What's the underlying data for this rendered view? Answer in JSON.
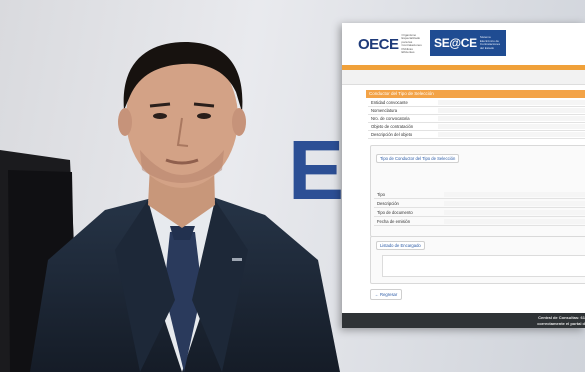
{
  "colors": {
    "accent_orange": "#f0a13a",
    "panel_header": "#f3a347",
    "seace_blue": "#1f4c92",
    "footer_bg": "#2f3336"
  },
  "background": {
    "brand_letter": "E"
  },
  "header": {
    "oece_logo": "OECE",
    "oece_sub": "Organismo Especializado para las Contrataciones Públicas Eficientes",
    "seace_logo": "SE@CE",
    "seace_sub": "Sistema Electrónico de Contrataciones del Estado"
  },
  "panel": {
    "title": "Conductor del Tipo de Selección",
    "fields": [
      "Entidad convocante",
      "Nomenclatura",
      "Nro. de convocatoria",
      "Objeto de contratación",
      "Descripción del objeto"
    ],
    "section_tipo": {
      "legend": "Tipo de Conductor del Tipo de Selección",
      "fields": [
        "Tipo",
        "Descripción",
        "Tipo de documento",
        "Fecha de emisión"
      ]
    },
    "section_list": {
      "legend": "Listado de Encargado"
    },
    "back_button": "← Regresar"
  },
  "footer": {
    "line1": "Central de Consultas: 61",
    "line2": "correctamente el portal d"
  }
}
